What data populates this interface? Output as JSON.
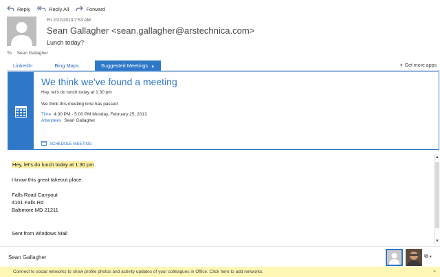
{
  "toolbar": {
    "reply_label": "Reply",
    "reply_all_label": "Reply All",
    "forward_label": "Forward"
  },
  "message": {
    "date": "Fri 2/22/2013 7:53 AM",
    "sender": "Sean Gallagher <sean.gallagher@arstechnica.com>",
    "subject": "Lunch today?",
    "to_label": "To",
    "to_name": "Sean Gallagher"
  },
  "apps_bar": {
    "tabs": [
      "LinkedIn",
      "Bing Maps",
      "Suggested Meetings"
    ],
    "active_tab": "Suggested Meetings",
    "get_more": "Get more apps"
  },
  "meeting_card": {
    "title": "We think we've found a meeting",
    "subtitle": "Hey, let's do lunch today at 1:30 pm",
    "status": "We think this meeting time has passed",
    "time_label": "Time",
    "time_value": "4:30 PM - 5:00 PM Monday, February 25, 2013",
    "attendees_label": "Attendees",
    "attendees_value": "Sean Gallagher",
    "schedule_button": "SCHEDULE MEETING"
  },
  "body": {
    "highlight": "Hey, let's do lunch today at 1:30 pm",
    "after_highlight": ".",
    "line2": "I know this great takeout place:",
    "address": [
      "Falls Road Carryout",
      "4101 Falls Rd",
      "Baltimore MD 21211"
    ],
    "signature": "Sent from Windows Mail"
  },
  "people_pane": {
    "name": "Sean Gallagher"
  },
  "notification": {
    "text": "Connect to social networks to show profile photos and activity updates of your colleagues in Office. Click here to add networks.",
    "close": "×"
  },
  "colors": {
    "accent": "#2f77c7",
    "highlight": "#fff2a8",
    "notification_bg": "#fff8b5"
  }
}
